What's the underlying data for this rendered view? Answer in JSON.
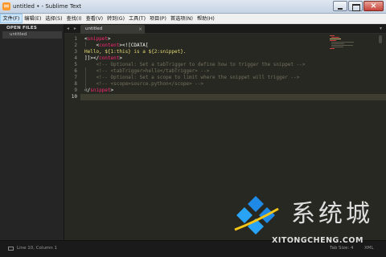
{
  "window": {
    "title": "untitled • - Sublime Text",
    "controls": [
      "minimize",
      "maximize",
      "close"
    ]
  },
  "menu": {
    "items": [
      "文件(F)",
      "编辑(E)",
      "选择(S)",
      "查找(I)",
      "查看(V)",
      "转到(G)",
      "工具(T)",
      "项目(P)",
      "首选项(N)",
      "帮助(H)"
    ]
  },
  "sidebar": {
    "header": "OPEN FILES",
    "files": [
      "untitled"
    ]
  },
  "tabs": {
    "nav": "◂ ▸",
    "items": [
      {
        "label": "untitled",
        "close": "×"
      }
    ],
    "dropdown": "▾"
  },
  "editor": {
    "current_line": 10,
    "lines": [
      {
        "num": "1",
        "tokens": [
          [
            "punc",
            "<"
          ],
          [
            "tag",
            "snippet"
          ],
          [
            "punc",
            ">"
          ]
        ]
      },
      {
        "num": "2",
        "tokens": [
          [
            "punc",
            "    <"
          ],
          [
            "tag",
            "content"
          ],
          [
            "punc",
            "><![CDATA["
          ]
        ]
      },
      {
        "num": "3",
        "tokens": [
          [
            "cdata",
            "Hello, ${1:this} is a ${2:snippet}."
          ]
        ]
      },
      {
        "num": "4",
        "tokens": [
          [
            "punc",
            "]]></"
          ],
          [
            "tag",
            "content"
          ],
          [
            "punc",
            ">"
          ]
        ]
      },
      {
        "num": "5",
        "tokens": [
          [
            "comment",
            "    <!-- Optional: Set a tabTrigger to define how to trigger the snippet -->"
          ]
        ]
      },
      {
        "num": "6",
        "tokens": [
          [
            "comment",
            "    <!-- <tabTrigger>hello</tabTrigger> -->"
          ]
        ]
      },
      {
        "num": "7",
        "tokens": [
          [
            "comment",
            "    <!-- Optional: Set a scope to limit where the snippet will trigger -->"
          ]
        ]
      },
      {
        "num": "8",
        "tokens": [
          [
            "comment",
            "    <!-- <scope>source.python</scope> -->"
          ]
        ]
      },
      {
        "num": "9",
        "tokens": [
          [
            "punc",
            "</"
          ],
          [
            "tag",
            "snippet"
          ],
          [
            "punc",
            ">"
          ]
        ]
      },
      {
        "num": "10",
        "tokens": []
      }
    ]
  },
  "status": {
    "position": "Line 10, Column 1",
    "tab_size": "Tab Size: 4",
    "syntax": "XML"
  },
  "watermark": {
    "text_cn": "系统城",
    "text_en": "XITONGCHENG.COM"
  },
  "colors": {
    "editor_bg": "#272822",
    "tag": "#f92672",
    "string": "#e6db74",
    "comment": "#75715e",
    "watermark_blue": "#1e8ae6"
  }
}
